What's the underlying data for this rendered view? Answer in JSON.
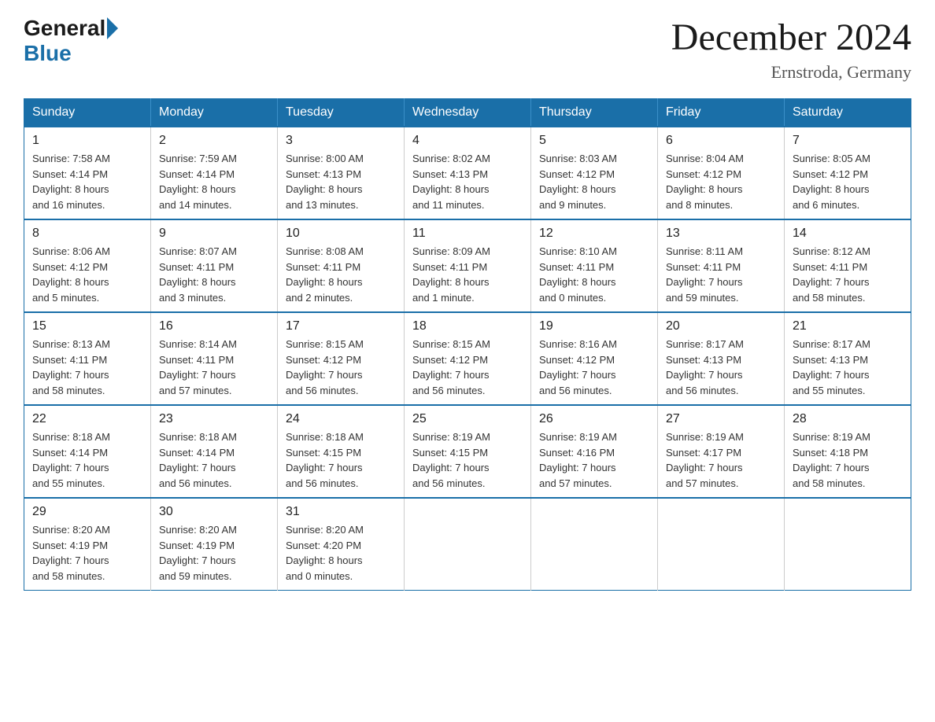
{
  "logo": {
    "general": "General",
    "blue": "Blue"
  },
  "title": "December 2024",
  "subtitle": "Ernstroda, Germany",
  "days_header": [
    "Sunday",
    "Monday",
    "Tuesday",
    "Wednesday",
    "Thursday",
    "Friday",
    "Saturday"
  ],
  "weeks": [
    [
      {
        "day": "1",
        "info": "Sunrise: 7:58 AM\nSunset: 4:14 PM\nDaylight: 8 hours\nand 16 minutes."
      },
      {
        "day": "2",
        "info": "Sunrise: 7:59 AM\nSunset: 4:14 PM\nDaylight: 8 hours\nand 14 minutes."
      },
      {
        "day": "3",
        "info": "Sunrise: 8:00 AM\nSunset: 4:13 PM\nDaylight: 8 hours\nand 13 minutes."
      },
      {
        "day": "4",
        "info": "Sunrise: 8:02 AM\nSunset: 4:13 PM\nDaylight: 8 hours\nand 11 minutes."
      },
      {
        "day": "5",
        "info": "Sunrise: 8:03 AM\nSunset: 4:12 PM\nDaylight: 8 hours\nand 9 minutes."
      },
      {
        "day": "6",
        "info": "Sunrise: 8:04 AM\nSunset: 4:12 PM\nDaylight: 8 hours\nand 8 minutes."
      },
      {
        "day": "7",
        "info": "Sunrise: 8:05 AM\nSunset: 4:12 PM\nDaylight: 8 hours\nand 6 minutes."
      }
    ],
    [
      {
        "day": "8",
        "info": "Sunrise: 8:06 AM\nSunset: 4:12 PM\nDaylight: 8 hours\nand 5 minutes."
      },
      {
        "day": "9",
        "info": "Sunrise: 8:07 AM\nSunset: 4:11 PM\nDaylight: 8 hours\nand 3 minutes."
      },
      {
        "day": "10",
        "info": "Sunrise: 8:08 AM\nSunset: 4:11 PM\nDaylight: 8 hours\nand 2 minutes."
      },
      {
        "day": "11",
        "info": "Sunrise: 8:09 AM\nSunset: 4:11 PM\nDaylight: 8 hours\nand 1 minute."
      },
      {
        "day": "12",
        "info": "Sunrise: 8:10 AM\nSunset: 4:11 PM\nDaylight: 8 hours\nand 0 minutes."
      },
      {
        "day": "13",
        "info": "Sunrise: 8:11 AM\nSunset: 4:11 PM\nDaylight: 7 hours\nand 59 minutes."
      },
      {
        "day": "14",
        "info": "Sunrise: 8:12 AM\nSunset: 4:11 PM\nDaylight: 7 hours\nand 58 minutes."
      }
    ],
    [
      {
        "day": "15",
        "info": "Sunrise: 8:13 AM\nSunset: 4:11 PM\nDaylight: 7 hours\nand 58 minutes."
      },
      {
        "day": "16",
        "info": "Sunrise: 8:14 AM\nSunset: 4:11 PM\nDaylight: 7 hours\nand 57 minutes."
      },
      {
        "day": "17",
        "info": "Sunrise: 8:15 AM\nSunset: 4:12 PM\nDaylight: 7 hours\nand 56 minutes."
      },
      {
        "day": "18",
        "info": "Sunrise: 8:15 AM\nSunset: 4:12 PM\nDaylight: 7 hours\nand 56 minutes."
      },
      {
        "day": "19",
        "info": "Sunrise: 8:16 AM\nSunset: 4:12 PM\nDaylight: 7 hours\nand 56 minutes."
      },
      {
        "day": "20",
        "info": "Sunrise: 8:17 AM\nSunset: 4:13 PM\nDaylight: 7 hours\nand 56 minutes."
      },
      {
        "day": "21",
        "info": "Sunrise: 8:17 AM\nSunset: 4:13 PM\nDaylight: 7 hours\nand 55 minutes."
      }
    ],
    [
      {
        "day": "22",
        "info": "Sunrise: 8:18 AM\nSunset: 4:14 PM\nDaylight: 7 hours\nand 55 minutes."
      },
      {
        "day": "23",
        "info": "Sunrise: 8:18 AM\nSunset: 4:14 PM\nDaylight: 7 hours\nand 56 minutes."
      },
      {
        "day": "24",
        "info": "Sunrise: 8:18 AM\nSunset: 4:15 PM\nDaylight: 7 hours\nand 56 minutes."
      },
      {
        "day": "25",
        "info": "Sunrise: 8:19 AM\nSunset: 4:15 PM\nDaylight: 7 hours\nand 56 minutes."
      },
      {
        "day": "26",
        "info": "Sunrise: 8:19 AM\nSunset: 4:16 PM\nDaylight: 7 hours\nand 57 minutes."
      },
      {
        "day": "27",
        "info": "Sunrise: 8:19 AM\nSunset: 4:17 PM\nDaylight: 7 hours\nand 57 minutes."
      },
      {
        "day": "28",
        "info": "Sunrise: 8:19 AM\nSunset: 4:18 PM\nDaylight: 7 hours\nand 58 minutes."
      }
    ],
    [
      {
        "day": "29",
        "info": "Sunrise: 8:20 AM\nSunset: 4:19 PM\nDaylight: 7 hours\nand 58 minutes."
      },
      {
        "day": "30",
        "info": "Sunrise: 8:20 AM\nSunset: 4:19 PM\nDaylight: 7 hours\nand 59 minutes."
      },
      {
        "day": "31",
        "info": "Sunrise: 8:20 AM\nSunset: 4:20 PM\nDaylight: 8 hours\nand 0 minutes."
      },
      null,
      null,
      null,
      null
    ]
  ]
}
